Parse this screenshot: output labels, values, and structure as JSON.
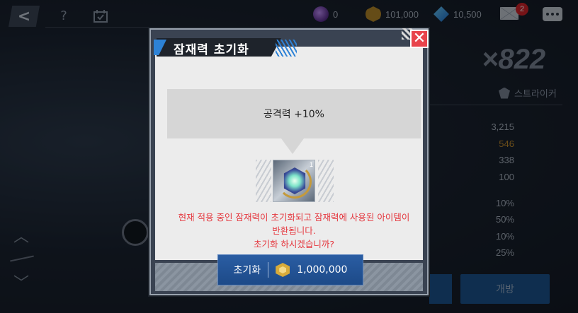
{
  "topbar": {
    "help_label": "?",
    "currencies": {
      "orb": "0",
      "gold": "101,000",
      "gem": "10,500"
    },
    "mail_badge": "2"
  },
  "side": {
    "multiplier": "×822",
    "class_label": "스트라이커",
    "stats": [
      "3,215",
      "546",
      "338",
      "100",
      "10%",
      "50%",
      "10%",
      "25%"
    ],
    "open_button": "개방"
  },
  "dialog": {
    "title": "잠재력 초기화",
    "close_glyph": "✕",
    "stat_text": "공격력 +10%",
    "item_count": "1",
    "warning_lines": [
      "현재 적용 중인 잠재력이 초기화되고 잠재력에 사용된 아이템이",
      "반환됩니다.",
      "초기화 하시겠습니까?"
    ],
    "reset_label": "초기화",
    "reset_cost": "1,000,000"
  },
  "colors": {
    "accent_blue": "#2d82d6",
    "warning_red": "#e5383f",
    "close_red": "#e8434b",
    "gold": "#d8ab3a"
  },
  "icons": [
    "back-arrow-icon",
    "help-icon",
    "calendar-icon",
    "orb-icon",
    "gold-coin-icon",
    "gem-icon",
    "mail-icon",
    "chat-icon",
    "close-icon",
    "potential-gem-icon",
    "arrow-up-icon",
    "arrow-down-icon"
  ]
}
